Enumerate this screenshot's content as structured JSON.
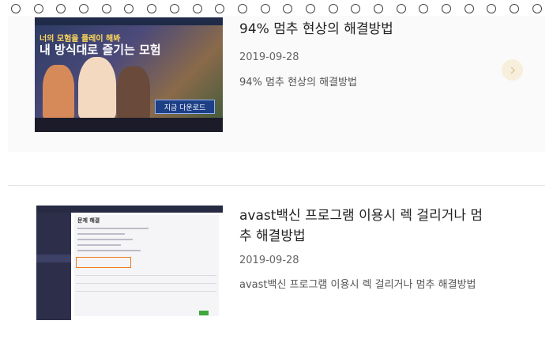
{
  "posts": [
    {
      "title": "94% 멈추 현상의 해결방법",
      "date": "2019-09-28",
      "excerpt": "94% 멈추 현상의 해결방법",
      "thumbnail": {
        "headline": "너의 모험을 플레이 해봐",
        "subheadline": "내 방식대로 즐기는 모험",
        "button": "지금 다운로드"
      }
    },
    {
      "title": "avast백신 프로그램 이용시 렉 걸리거나 멈추 해결방법",
      "date": "2019-09-28",
      "excerpt": "avast백신 프로그램 이용시 렉 걸리거나 멈추 해결방법",
      "thumbnail": {
        "panel_title": "문제 해결"
      }
    }
  ],
  "icons": {
    "next": "chevron-right-icon"
  },
  "colors": {
    "next_button_bg": "#f7efdc",
    "avast_highlight": "#f07a1a"
  }
}
